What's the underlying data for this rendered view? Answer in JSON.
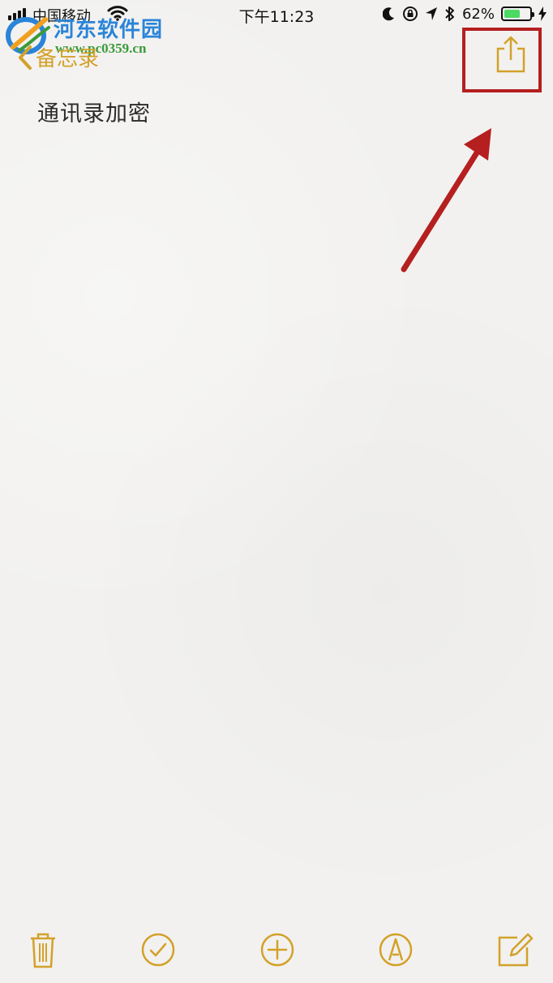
{
  "status_bar": {
    "carrier": "中国移动",
    "time": "下午11:23",
    "battery_percent_label": "62%",
    "battery_level": 0.62,
    "icons": [
      "signal-icon",
      "wifi-icon",
      "moon-icon",
      "orientation-lock-icon",
      "location-icon",
      "bluetooth-icon",
      "battery-icon",
      "charging-icon"
    ]
  },
  "watermark": {
    "title": "河东软件园",
    "url": "www.pc0359.cn"
  },
  "nav": {
    "back_label": "备忘录",
    "back_icon": "chevron-left-icon",
    "share_icon": "share-icon"
  },
  "note": {
    "title": "通讯录加密"
  },
  "toolbar": {
    "items": [
      "trash-icon",
      "checklist-icon",
      "add-icon",
      "markup-icon",
      "compose-icon"
    ]
  },
  "colors": {
    "accent": "#d3a12a",
    "highlight": "#b51f1f",
    "battery": "#4cd964",
    "watermark_blue": "#2a84d8",
    "watermark_green": "#3a9a3a"
  }
}
